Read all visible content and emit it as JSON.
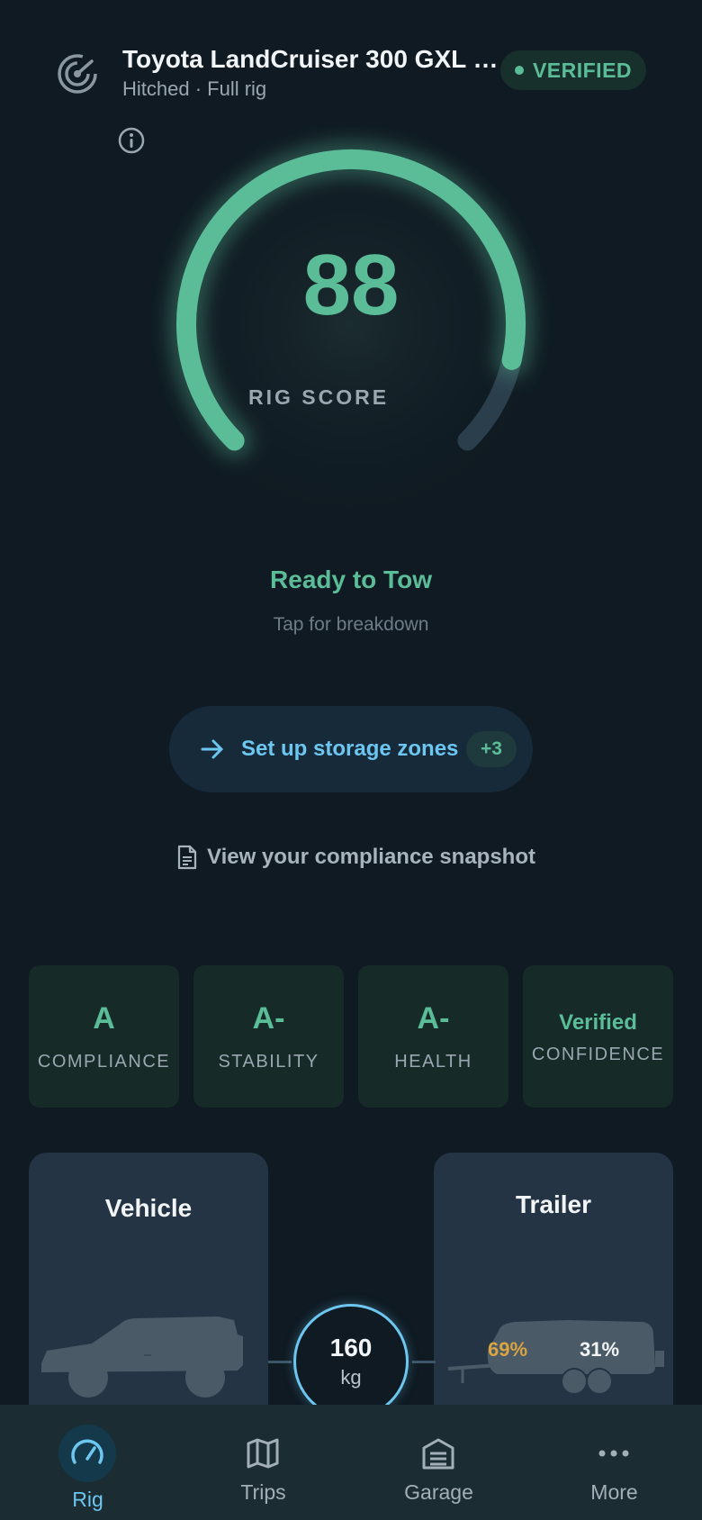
{
  "header": {
    "icon": "radar-icon",
    "title": "Toyota LandCruiser 300 GXL …",
    "subtitle": "Hitched · Full rig",
    "badge": "VERIFIED"
  },
  "gauge": {
    "score": "88",
    "score_value": 88,
    "score_max": 100,
    "label": "RIG SCORE",
    "info_icon": "info-icon"
  },
  "status": {
    "headline": "Ready to Tow",
    "hint": "Tap for breakdown"
  },
  "storage_button": {
    "label": "Set up storage zones",
    "count": "+3",
    "icon": "arrow-right-icon"
  },
  "compliance_link": {
    "label": "View your compliance snapshot",
    "icon": "document-icon"
  },
  "grades": [
    {
      "value": "A",
      "label": "COMPLIANCE"
    },
    {
      "value": "A-",
      "label": "STABILITY"
    },
    {
      "value": "A-",
      "label": "HEALTH"
    },
    {
      "value": "Verified",
      "label": "CONFIDENCE"
    }
  ],
  "rig": {
    "vehicle_title": "Vehicle",
    "trailer_title": "Trailer",
    "trailer_front_pct": "69%",
    "trailer_rear_pct": "31%",
    "hitch_value": "160",
    "hitch_unit": "kg"
  },
  "colors": {
    "accent_green": "#5bbd98",
    "accent_blue": "#6cc6f0",
    "warning_amber": "#d9a441",
    "background": "#0f1a22"
  },
  "tabs": [
    {
      "label": "Rig",
      "icon": "speedometer-icon",
      "active": true
    },
    {
      "label": "Trips",
      "icon": "map-icon",
      "active": false
    },
    {
      "label": "Garage",
      "icon": "garage-icon",
      "active": false
    },
    {
      "label": "More",
      "icon": "more-dots-icon",
      "active": false
    }
  ]
}
